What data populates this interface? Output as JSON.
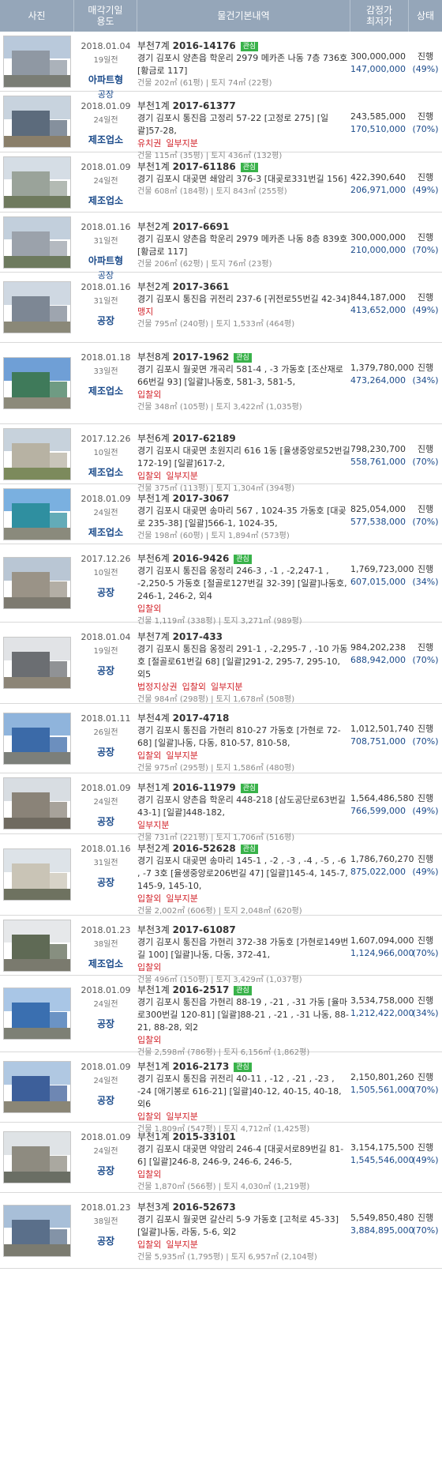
{
  "header": {
    "photo": "사진",
    "date_use_1": "매각기일",
    "date_use_2": "용도",
    "info": "물건기본내역",
    "price_1": "감정가",
    "price_2": "최저가",
    "status": "상태"
  },
  "items": [
    {
      "date": "2018.01.04",
      "ago": "19일전",
      "usage": "아파트형",
      "sub": "공장",
      "court": "부천7계",
      "case": "2016-14176",
      "badge": "관심",
      "addr": "경기 김포시 양촌읍 학운리 2979 메카존 나동 7층 736호 [황금로 117]",
      "tags": [],
      "area": "건물 202㎡ (61평) | 토지 74㎡ (22평)",
      "appraised": "300,000,000",
      "min": "147,000,000",
      "status": "진행",
      "pct": "(49%)",
      "palette": [
        "#b9c9db",
        "#8f98a3",
        "#7a7d75"
      ]
    },
    {
      "date": "2018.01.09",
      "ago": "24일전",
      "usage": "제조업소",
      "sub": "",
      "court": "부천1계",
      "case": "2017-61377",
      "badge": "",
      "addr": "경기 김포시 통진읍 고정리 57-22 [고정로 275] [일괄]57-28,",
      "tags": [
        "유치권",
        "일부지분"
      ],
      "area": "건물 115㎡ (35평) | 토지 436㎡ (132평)",
      "appraised": "243,585,000",
      "min": "170,510,000",
      "status": "진행",
      "pct": "(70%)",
      "palette": [
        "#c8d3de",
        "#5c6b7c",
        "#8a7f6a"
      ]
    },
    {
      "date": "2018.01.09",
      "ago": "24일전",
      "usage": "제조업소",
      "sub": "",
      "court": "부천1계",
      "case": "2017-61186",
      "badge": "관심",
      "addr": "경기 김포시 대곶면 쇄암리 376-3 [대곶로331번길 156]",
      "tags": [],
      "area": "건물 608㎡ (184평) | 토지 843㎡ (255평)",
      "appraised": "422,390,640",
      "min": "206,971,000",
      "status": "진행",
      "pct": "(49%)",
      "palette": [
        "#d5dde5",
        "#9aa39a",
        "#6f7a5e"
      ]
    },
    {
      "date": "2018.01.16",
      "ago": "31일전",
      "usage": "아파트형",
      "sub": "공장",
      "court": "부천2계",
      "case": "2017-6691",
      "badge": "",
      "addr": "경기 김포시 양촌읍 학운리 2979 메카존 나동 8층 839호 [황금로 117]",
      "tags": [],
      "area": "건물 206㎡ (62평) | 토지 76㎡ (23평)",
      "appraised": "300,000,000",
      "min": "210,000,000",
      "status": "진행",
      "pct": "(70%)",
      "palette": [
        "#c2cfdc",
        "#9ba2ab",
        "#6d7a5e"
      ]
    },
    {
      "date": "2018.01.16",
      "ago": "31일전",
      "usage": "공장",
      "sub": "",
      "court": "부천2계",
      "case": "2017-3661",
      "badge": "",
      "addr": "경기 김포시 통진읍 귀전리 237-6 [귀전로55번길 42-34]",
      "tags": [
        "맹지"
      ],
      "area": "건물 795㎡ (240평) | 토지 1,533㎡ (464평)",
      "appraised": "844,187,000",
      "min": "413,652,000",
      "status": "진행",
      "pct": "(49%)",
      "palette": [
        "#cfd8e2",
        "#7d8794",
        "#8a8878"
      ]
    },
    {
      "date": "2018.01.18",
      "ago": "33일전",
      "usage": "제조업소",
      "sub": "",
      "court": "부천8계",
      "case": "2017-1962",
      "badge": "관심",
      "addr": "경기 김포시 월곶면 개곡리 581-4 , -3 가동호 [조산재로66번길 93] [일괄]나동호, 581-3, 581-5,",
      "tags": [
        "입찰외"
      ],
      "area": "건물 348㎡ (105평) | 토지 3,422㎡ (1,035평)",
      "appraised": "1,379,780,000",
      "min": "473,264,000",
      "status": "진행",
      "pct": "(34%)",
      "palette": [
        "#6f9fd6",
        "#3f7a5a",
        "#8c8a7a"
      ]
    },
    {
      "date": "2017.12.26",
      "ago": "10일전",
      "usage": "제조업소",
      "sub": "",
      "court": "부천6계",
      "case": "2017-62189",
      "badge": "",
      "addr": "경기 김포시 대곶면 초원지리 616 1동 [율생중앙로52번길 172-19] [일괄]617-2,",
      "tags": [
        "입찰외",
        "일부지분"
      ],
      "area": "건물 375㎡ (113평) | 토지 1,304㎡ (394평)",
      "appraised": "798,230,700",
      "min": "558,761,000",
      "status": "진행",
      "pct": "(70%)",
      "palette": [
        "#c7d2dc",
        "#b7b2a3",
        "#7c8a5c"
      ]
    },
    {
      "date": "2018.01.09",
      "ago": "24일전",
      "usage": "제조업소",
      "sub": "",
      "court": "부천1계",
      "case": "2017-3067",
      "badge": "",
      "addr": "경기 김포시 대곶면 송마리 567 , 1024-35 가동호 [대곶로 235-38] [일괄]566-1, 1024-35,",
      "tags": [],
      "area": "건물 198㎡ (60평) | 토지 1,894㎡ (573평)",
      "appraised": "825,054,000",
      "min": "577,538,000",
      "status": "진행",
      "pct": "(70%)",
      "palette": [
        "#7ab0e0",
        "#2f8fa0",
        "#8a8a7c"
      ]
    },
    {
      "date": "2017.12.26",
      "ago": "10일전",
      "usage": "공장",
      "sub": "",
      "court": "부천6계",
      "case": "2016-9426",
      "badge": "관심",
      "addr": "경기 김포시 통진읍 옹정리 246-3 , -1 , -2,247-1 , -2,250-5 가동호 [절골로127번길 32-39] [일괄]나동호, 246-1, 246-2, 외4",
      "tags": [
        "입찰외"
      ],
      "area": "건물 1,119㎡ (338평) | 토지 3,271㎡ (989평)",
      "appraised": "1,769,723,000",
      "min": "607,015,000",
      "status": "진행",
      "pct": "(34%)",
      "palette": [
        "#b9c6d4",
        "#9a9387",
        "#7d7a70"
      ]
    },
    {
      "date": "2018.01.04",
      "ago": "19일전",
      "usage": "공장",
      "sub": "",
      "court": "부천7계",
      "case": "2017-433",
      "badge": "",
      "addr": "경기 김포시 통진읍 옹정리 291-1 , -2,295-7 , -10 가동호 [절골로61번길 68] [일괄]291-2, 295-7, 295-10, 외5",
      "tags": [
        "법정지상권",
        "입찰외",
        "일부지분"
      ],
      "area": "건물 984㎡ (298평) | 토지 1,678㎡ (508평)",
      "appraised": "984,202,238",
      "min": "688,942,000",
      "status": "진행",
      "pct": "(70%)",
      "palette": [
        "#e1e3e6",
        "#6b6e72",
        "#8c8577"
      ]
    },
    {
      "date": "2018.01.11",
      "ago": "26일전",
      "usage": "공장",
      "sub": "",
      "court": "부천4계",
      "case": "2017-4718",
      "badge": "",
      "addr": "경기 김포시 통진읍 가현리 810-27 가동호 [가현로 72-68] [일괄]나동, 다동, 810-57, 810-58,",
      "tags": [
        "입찰외",
        "일부지분"
      ],
      "area": "건물 975㎡ (295평) | 토지 1,586㎡ (480평)",
      "appraised": "1,012,501,740",
      "min": "708,751,000",
      "status": "진행",
      "pct": "(70%)",
      "palette": [
        "#8fb4dc",
        "#3b6aa8",
        "#7c7f7a"
      ]
    },
    {
      "date": "2018.01.09",
      "ago": "24일전",
      "usage": "공장",
      "sub": "",
      "court": "부천1계",
      "case": "2016-11979",
      "badge": "관심",
      "addr": "경기 김포시 양촌읍 학운리 448-218 [삼도공단로63번길 43-1] [일괄]448-182,",
      "tags": [
        "일부지분"
      ],
      "area": "건물 731㎡ (221평) | 토지 1,706㎡ (516평)",
      "appraised": "1,564,486,580",
      "min": "766,599,000",
      "status": "진행",
      "pct": "(49%)",
      "palette": [
        "#d8dde2",
        "#8a8378",
        "#6f6a60"
      ]
    },
    {
      "date": "2018.01.16",
      "ago": "31일전",
      "usage": "공장",
      "sub": "",
      "court": "부천2계",
      "case": "2016-52628",
      "badge": "관심",
      "addr": "경기 김포시 대곶면 송마리 145-1 , -2 , -3 , -4 , -5 , -6 , -7 3호 [율생중앙로206번길 47] [일괄]145-4, 145-7, 145-9, 145-10,",
      "tags": [
        "입찰외",
        "일부지분"
      ],
      "area": "건물 2,002㎡ (606평) | 토지 2,048㎡ (620평)",
      "appraised": "1,786,760,270",
      "min": "875,022,000",
      "status": "진행",
      "pct": "(49%)",
      "palette": [
        "#dde3e8",
        "#c9c4b6",
        "#6e7260"
      ]
    },
    {
      "date": "2018.01.23",
      "ago": "38일전",
      "usage": "제조업소",
      "sub": "",
      "court": "부천3계",
      "case": "2017-61087",
      "badge": "",
      "addr": "경기 김포시 통진읍 가현리 372-38 가동호 [가현로149번길 100] [일괄]나동, 다동, 372-41,",
      "tags": [
        "입찰외"
      ],
      "area": "건물 496㎡ (150평) | 토지 3,429㎡ (1,037평)",
      "appraised": "1,607,094,000",
      "min": "1,124,966,000",
      "status": "진행",
      "pct": "(70%)",
      "palette": [
        "#e6e8ea",
        "#5f6a55",
        "#7a7a6e"
      ]
    },
    {
      "date": "2018.01.09",
      "ago": "24일전",
      "usage": "공장",
      "sub": "",
      "court": "부천1계",
      "case": "2016-2517",
      "badge": "관심",
      "addr": "경기 김포시 통진읍 가현리 88-19 , -21 , -31 가동 [율마로300번길 120-81] [일괄]88-21 , -21 , -31 나동, 88-21, 88-28, 외2",
      "tags": [
        "입찰외"
      ],
      "area": "건물 2,598㎡ (786평) | 토지 6,156㎡ (1,862평)",
      "appraised": "3,534,758,000",
      "min": "1,212,422,000",
      "status": "진행",
      "pct": "(34%)",
      "palette": [
        "#a9c6e6",
        "#3a6fb0",
        "#7d8075"
      ]
    },
    {
      "date": "2018.01.09",
      "ago": "24일전",
      "usage": "공장",
      "sub": "",
      "court": "부천1계",
      "case": "2016-2173",
      "badge": "관심",
      "addr": "경기 김포시 통진읍 귀전리 40-11 , -12 , -21 , -23 , -24 [애기봉로 616-21] [일괄]40-12, 40-15, 40-18, 외6",
      "tags": [
        "입찰외",
        "일부지분"
      ],
      "area": "건물 1,809㎡ (547평) | 토지 4,712㎡ (1,425평)",
      "appraised": "2,150,801,260",
      "min": "1,505,561,000",
      "status": "진행",
      "pct": "(70%)",
      "palette": [
        "#b0c8e2",
        "#3d5f9a",
        "#8a8676"
      ]
    },
    {
      "date": "2018.01.09",
      "ago": "24일전",
      "usage": "공장",
      "sub": "",
      "court": "부천1계",
      "case": "2015-33101",
      "badge": "",
      "addr": "경기 김포시 대곶면 약암리 246-4 [대곶서로89번길 81-6] [일괄]246-8, 246-9, 246-6, 246-5,",
      "tags": [
        "입찰외"
      ],
      "area": "건물 1,870㎡ (566평) | 토지 4,030㎡ (1,219평)",
      "appraised": "3,154,175,500",
      "min": "1,545,546,000",
      "status": "진행",
      "pct": "(49%)",
      "palette": [
        "#dfe3e6",
        "#8e8b80",
        "#6a6e64"
      ]
    },
    {
      "date": "2018.01.23",
      "ago": "38일전",
      "usage": "공장",
      "sub": "",
      "court": "부천3계",
      "case": "2016-52673",
      "badge": "",
      "addr": "경기 김포시 월곶면 갈산리 5-9 가동호 [고척로 45-33] [일괄]나동, 라동, 5-6, 외2",
      "tags": [
        "입찰외",
        "일부지분"
      ],
      "area": "건물 5,935㎡ (1,795평) | 토지 6,957㎡ (2,104평)",
      "appraised": "5,549,850,480",
      "min": "3,884,895,000",
      "status": "진행",
      "pct": "(70%)",
      "palette": [
        "#a8bfd8",
        "#5a6f8a",
        "#7b7b70"
      ]
    }
  ]
}
